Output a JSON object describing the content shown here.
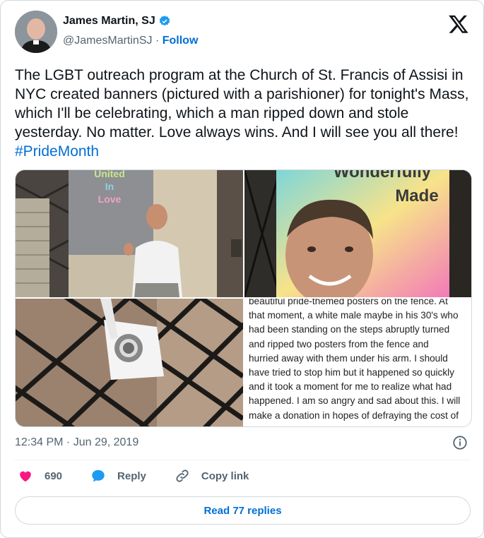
{
  "author": {
    "name": "James Martin, SJ",
    "handle": "@JamesMartinSJ",
    "separator": "·",
    "follow_label": "Follow"
  },
  "tweet": {
    "text": "The LGBT outreach program at the Church of St. Francis of Assisi in NYC created banners (pictured with a parishioner) for tonight's Mass, which I'll be celebrating, which a man ripped down and stole yesterday. No matter. Love always wins. And I will see you all there! ",
    "hashtag": "#PrideMonth",
    "timestamp": "12:34 PM · Jun 29, 2019"
  },
  "media": {
    "banner1_text": [
      "United",
      "In",
      "Love"
    ],
    "banner2_text": [
      "Wonderfully",
      "Made"
    ],
    "note_text": "beautiful pride-themed posters on the fence. At that moment, a white male maybe in his 30's who had been standing on the steps abruptly turned and ripped two posters from the fence and hurried away with them under his arm. I should have tried to stop him but it happened so quickly and it took a moment for me to realize what had happened. I am so angry and sad about this. I will make a donation in hopes of defraying the cost of"
  },
  "actions": {
    "like_count": "690",
    "reply_label": "Reply",
    "copy_label": "Copy link"
  },
  "read_replies": "Read 77 replies",
  "colors": {
    "accent": "#006fd6",
    "like": "#f91880",
    "reply": "#1d9bf0",
    "muted": "#536471"
  }
}
